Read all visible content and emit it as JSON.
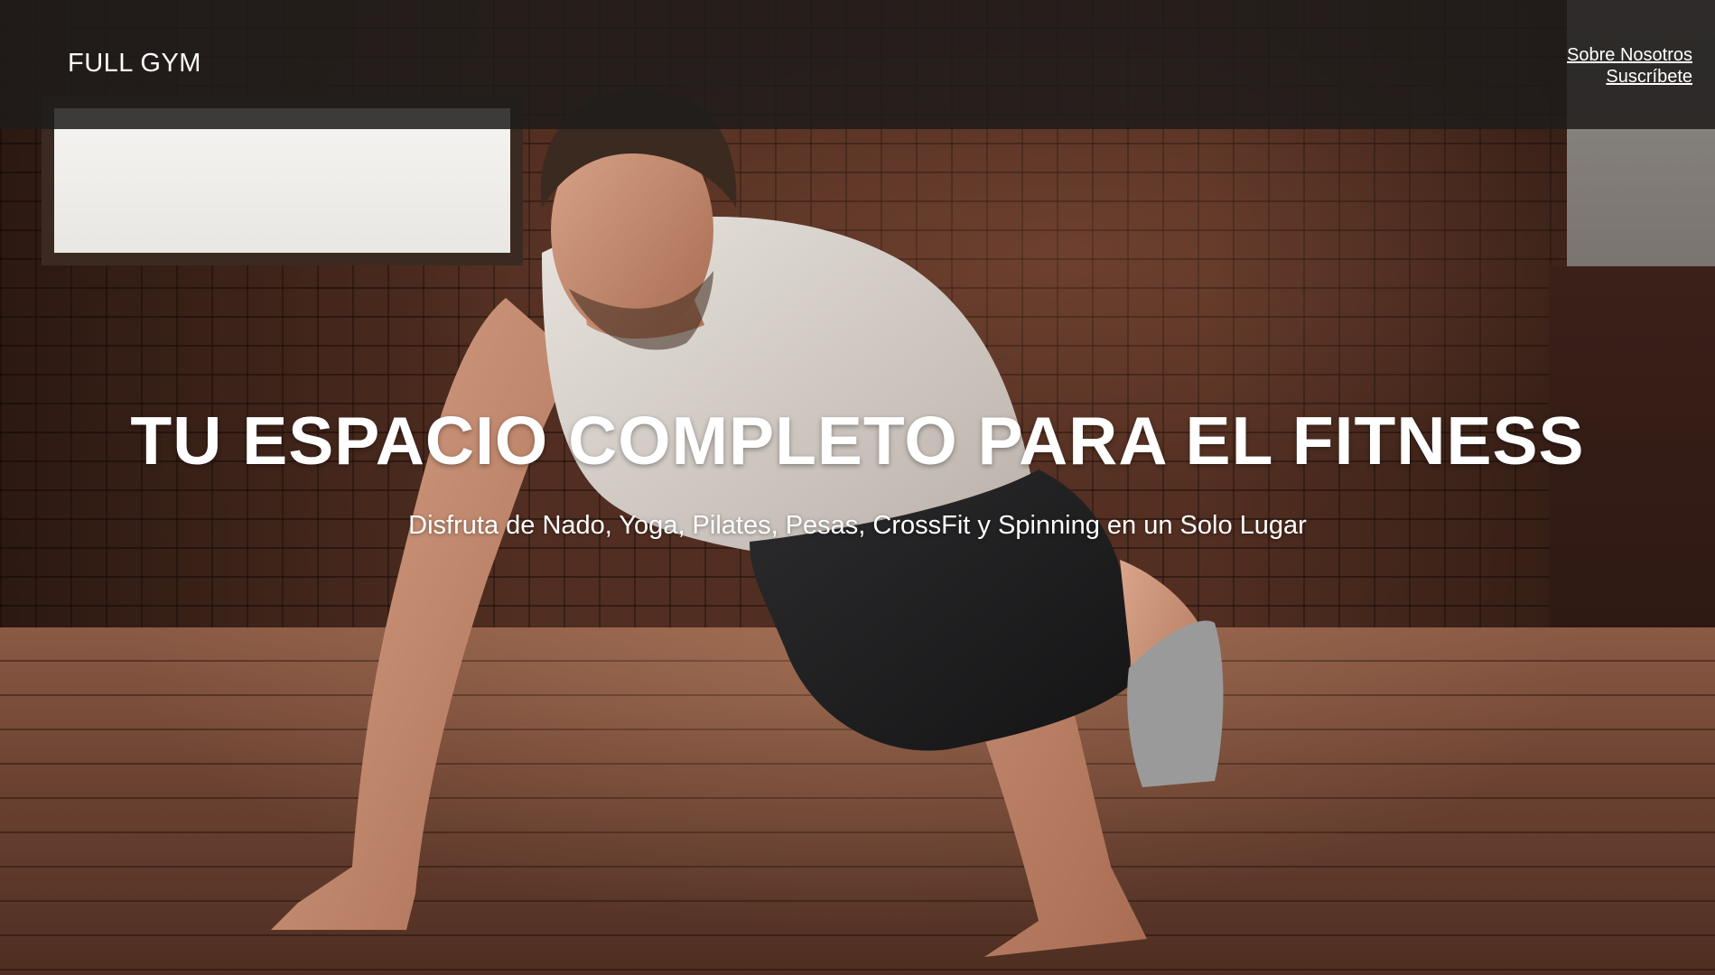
{
  "header": {
    "brand": "FULL GYM",
    "nav": [
      {
        "label": "Sobre Nosotros"
      },
      {
        "label": "Suscríbete"
      }
    ]
  },
  "hero": {
    "title": "TU ESPACIO COMPLETO PARA EL FITNESS",
    "subtitle": "Disfruta de Nado, Yoga, Pilates, Pesas, CrossFit y Spinning en un Solo Lugar",
    "background_image": "man-doing-push-ups-gym-photo"
  },
  "colors": {
    "header_bg": "#1e1c1b",
    "text": "#ffffff",
    "brick": "#5a3325",
    "floor": "#6b4232"
  }
}
